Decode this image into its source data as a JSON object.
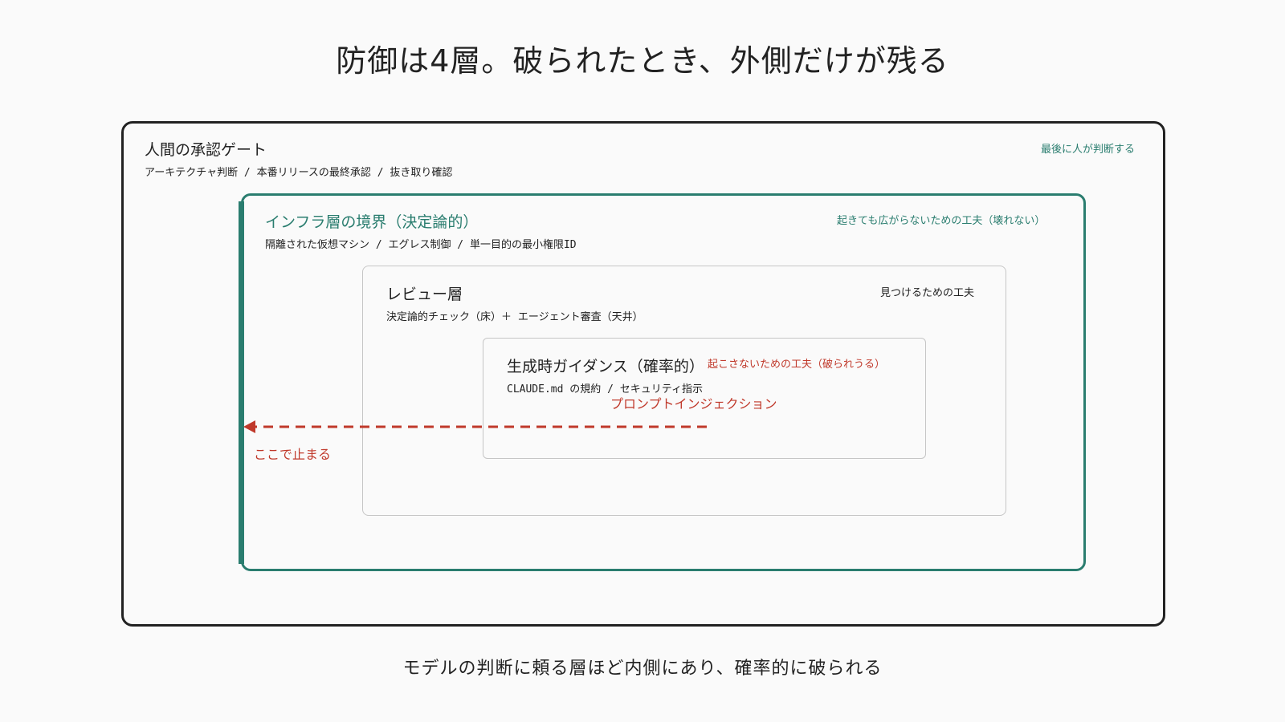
{
  "title": "防御は4層。破られたとき、外側だけが残る",
  "footer": "モデルの判断に頼る層ほど内側にあり、確率的に破られる",
  "layers": {
    "human": {
      "name": "人間の承認ゲート",
      "items": "アーキテクチャ判断 / 本番リリースの最終承認 / 抜き取り確認",
      "note": "最後に人が判断する"
    },
    "infra": {
      "name": "インフラ層の境界（決定論的）",
      "items": "隔離された仮想マシン / エグレス制御 / 単一目的の最小権限ID",
      "note": "起きても広がらないための工夫（壊れない）"
    },
    "review": {
      "name": "レビュー層",
      "items": "決定論的チェック（床）＋ エージェント審査（天井）",
      "note": "見つけるための工夫"
    },
    "generation": {
      "name": "生成時ガイダンス（確率的）",
      "items": "CLAUDE.md の規約 / セキュリティ指示",
      "note": "起こさないための工夫（破られうる）"
    }
  },
  "attack": {
    "label": "プロンプトインジェクション",
    "stop_label": "ここで止まる"
  },
  "colors": {
    "teal": "#2a7d6f",
    "red": "#c0392b",
    "outline": "#222222",
    "inner_border": "#c6c6c6"
  }
}
